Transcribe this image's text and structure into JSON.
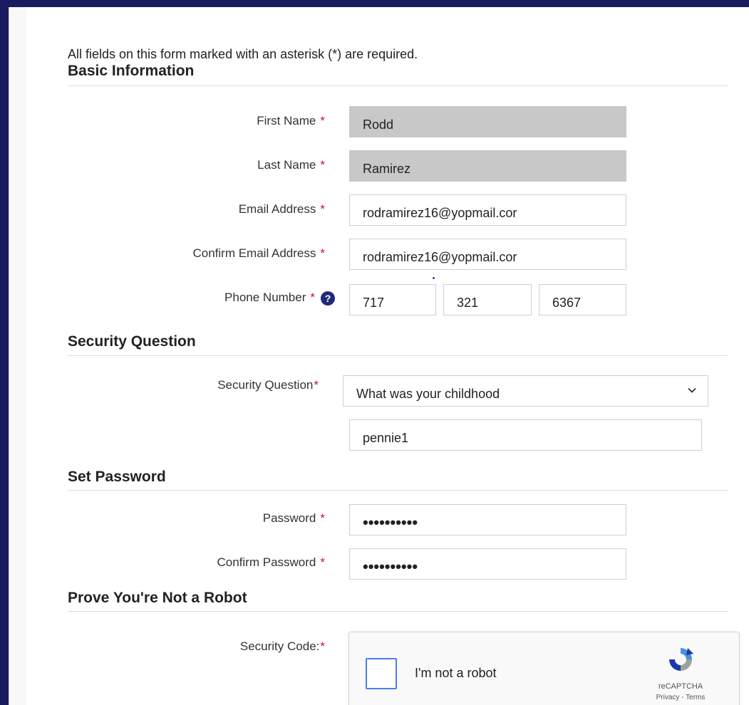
{
  "form": {
    "required_note": "All fields on this form marked with an asterisk (*) are required.",
    "star": "*"
  },
  "basic": {
    "title": "Basic Information",
    "first_name": {
      "label": "First Name",
      "value": "Rodd"
    },
    "last_name": {
      "label": "Last Name",
      "value": "Ramirez"
    },
    "email": {
      "label": "Email Address",
      "value": "rodramirez16@yopmail.cor"
    },
    "confirm_email": {
      "label": "Confirm Email Address",
      "value": "rodramirez16@yopmail.cor"
    },
    "phone": {
      "label": "Phone Number",
      "area": "717",
      "prefix": "321",
      "line": "6367",
      "help_icon": "question-circle-icon",
      "help_glyph": "?"
    }
  },
  "security": {
    "title": "Security Question",
    "question_label": "Security Question",
    "question_value": "What was your childhood",
    "answer_value": "pennie1"
  },
  "password": {
    "title": "Set Password",
    "password_label": "Password",
    "password_value": "••••••••••",
    "confirm_label": "Confirm Password",
    "confirm_value": "••••••••••"
  },
  "robot": {
    "title": "Prove You're Not a Robot",
    "code_label": "Security Code:",
    "checkbox_label": "I'm not a robot",
    "brand": "reCAPTCHA",
    "links": "Privacy - Terms"
  },
  "colors": {
    "required_star": "#c8102e",
    "help_icon": "#1e2a78",
    "readonly_bg": "#c8c8c8",
    "checkbox_border": "#4a7df0",
    "outer_border": "#1a1a5e"
  }
}
